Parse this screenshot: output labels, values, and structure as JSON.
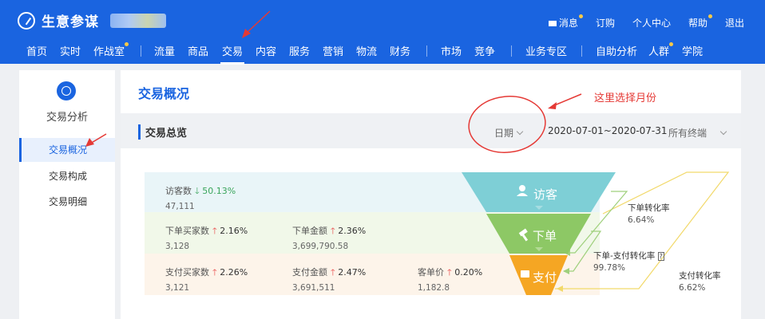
{
  "header": {
    "app_name": "生意参谋",
    "messages": "消息",
    "subscribe": "订购",
    "personal_center": "个人中心",
    "help": "帮助",
    "logout": "退出"
  },
  "nav": [
    "首页",
    "实时",
    "作战室",
    "流量",
    "商品",
    "交易",
    "内容",
    "服务",
    "营销",
    "物流",
    "财务",
    "市场",
    "竞争",
    "业务专区",
    "自助分析",
    "人群",
    "学院"
  ],
  "sidebar": {
    "title": "交易分析",
    "items": [
      "交易概况",
      "交易构成",
      "交易明细"
    ]
  },
  "main": {
    "title": "交易概况",
    "overview_title": "交易总览",
    "date_label": "日期",
    "date_range": "2020-07-01~2020-07-31",
    "terminal": "所有终端"
  },
  "metrics": {
    "visitors": {
      "label": "访客数",
      "change": "50.13%",
      "value": "47,111"
    },
    "order_buyers": {
      "label": "下单买家数",
      "change": "2.16%",
      "value": "3,128"
    },
    "order_amount": {
      "label": "下单金额",
      "change": "2.36%",
      "value": "3,699,790.58"
    },
    "pay_buyers": {
      "label": "支付买家数",
      "change": "2.26%",
      "value": "3,121"
    },
    "pay_amount": {
      "label": "支付金额",
      "change": "2.47%",
      "value": "3,691,511"
    },
    "unit_price": {
      "label": "客单价",
      "change": "0.20%",
      "value": "1,182.8"
    }
  },
  "funnel": {
    "stage1": "访客",
    "stage2": "下单",
    "stage3": "支付",
    "order_rate_label": "下单转化率",
    "order_rate": "6.64%",
    "order_pay_label": "下单-支付转化率",
    "order_pay_rate": "99.78%",
    "pay_rate_label": "支付转化率",
    "pay_rate": "6.62%",
    "colors": {
      "visitor": "#7ecfd6",
      "order": "#8dc865",
      "pay": "#f5a623"
    }
  },
  "annotation": "这里选择月份"
}
